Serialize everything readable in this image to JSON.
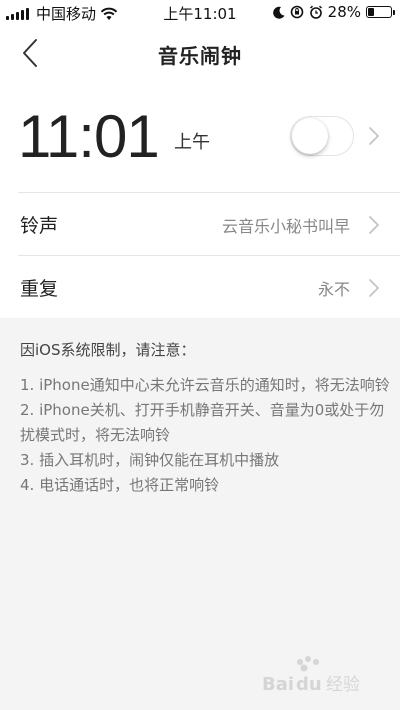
{
  "status_bar": {
    "carrier": "中国移动",
    "time": "上午11:01",
    "battery_percent": "28%",
    "battery_level": 0.28,
    "icons": [
      "signal-icon",
      "wifi-icon",
      "moon-icon",
      "rotation-lock-icon",
      "alarm-icon",
      "battery-icon"
    ]
  },
  "nav": {
    "title": "音乐闹钟",
    "back_icon": "chevron-left-icon"
  },
  "alarm": {
    "time": "11:01",
    "period": "上午",
    "enabled": false
  },
  "settings": {
    "ringtone": {
      "label": "铃声",
      "value": "云音乐小秘书叫早"
    },
    "repeat": {
      "label": "重复",
      "value": "永不"
    }
  },
  "notice": {
    "title": "因iOS系统限制，请注意：",
    "items": [
      "1. iPhone通知中心未允许云音乐的通知时，将无法响铃",
      "2. iPhone关机、打开手机静音开关、音量为0或处于勿扰模式时，将无法响铃",
      "3. 插入耳机时，闹钟仅能在耳机中播放",
      "4. 电话通话时，也将正常响铃"
    ]
  },
  "colors": {
    "background": "#f4f4f4",
    "card": "#ffffff",
    "text_primary": "#222222",
    "text_secondary": "#888888",
    "divider": "#e5e5e5"
  },
  "watermark": {
    "text": "Baidu 经验"
  }
}
